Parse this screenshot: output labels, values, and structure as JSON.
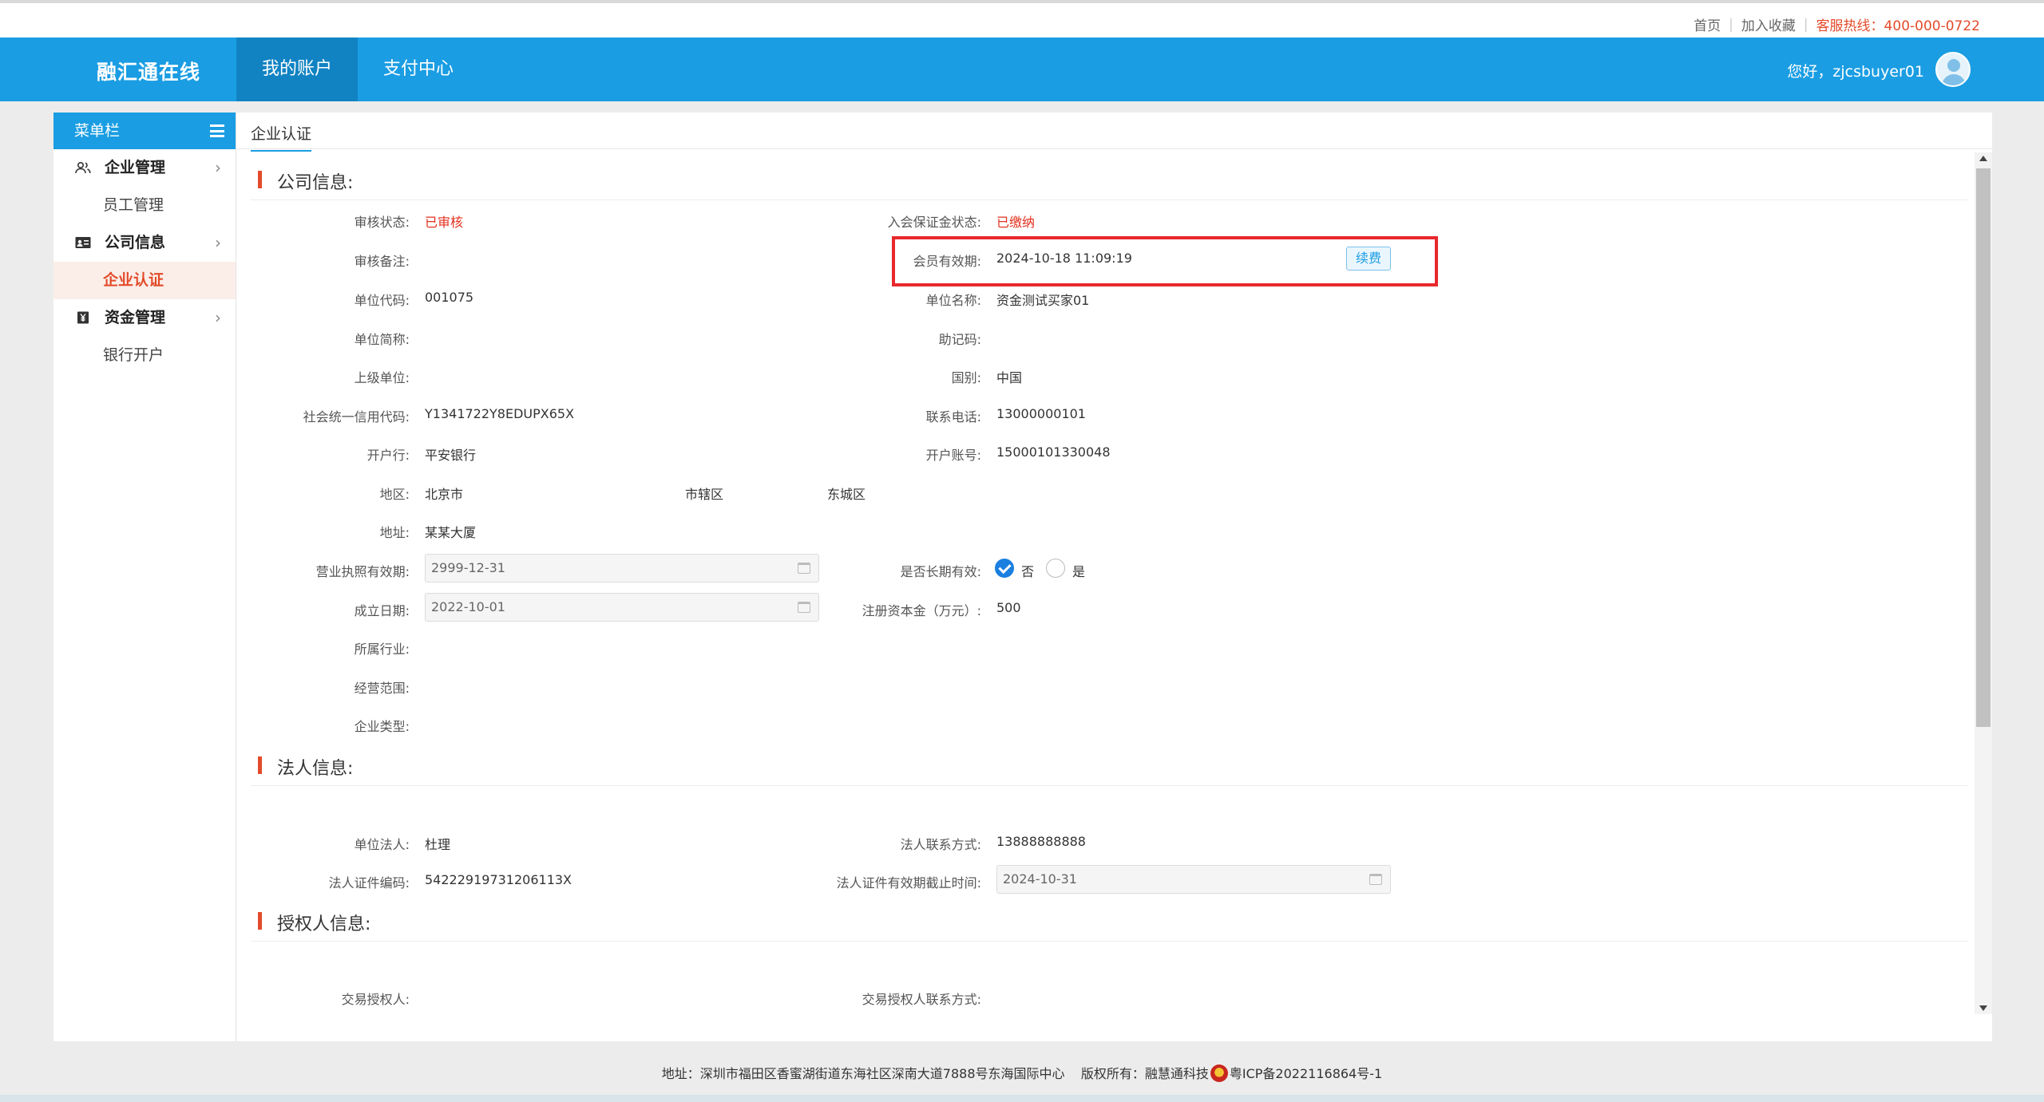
{
  "toplinks": {
    "home": "首页",
    "favorite": "加入收藏",
    "hotline": "客服热线：400-000-0722"
  },
  "header": {
    "logo": "融汇通在线",
    "nav": [
      "我的账户",
      "支付中心"
    ],
    "greeting": "您好，zjcsbuyer01"
  },
  "sidebar": {
    "title": "菜单栏",
    "groups": [
      {
        "label": "企业管理",
        "icon": "users-icon",
        "subs": [
          "员工管理"
        ]
      },
      {
        "label": "公司信息",
        "icon": "id-card-icon",
        "subs": [
          "企业认证"
        ]
      },
      {
        "label": "资金管理",
        "icon": "yen-box-icon",
        "subs": [
          "银行开户"
        ]
      }
    ],
    "active": "企业认证"
  },
  "tab": "企业认证",
  "company": {
    "title": "公司信息:",
    "audit_status_label": "审核状态:",
    "audit_status": "已审核",
    "deposit_label": "入会保证金状态:",
    "deposit": "已缴纳",
    "audit_note_label": "审核备注:",
    "member_expiry_label": "会员有效期:",
    "member_expiry": "2024-10-18 11:09:19",
    "renew": "续费",
    "unit_code_label": "单位代码:",
    "unit_code": "001075",
    "unit_name_label": "单位名称:",
    "unit_name": "资金测试买家01",
    "short_name_label": "单位简称:",
    "mnemonic_label": "助记码:",
    "parent_label": "上级单位:",
    "country_label": "国别:",
    "country": "中国",
    "credit_code_label": "社会统一信用代码:",
    "credit_code": "Y1341722Y8EDUPX65X",
    "phone_label": "联系电话:",
    "phone": "13000000101",
    "bank_label": "开户行:",
    "bank": "平安银行",
    "account_label": "开户账号:",
    "account": "15000101330048",
    "region_label": "地区:",
    "region": [
      "北京市",
      "市辖区",
      "东城区"
    ],
    "address_label": "地址:",
    "address": "某某大厦",
    "license_expiry_label": "营业执照有效期:",
    "license_expiry": "2999-12-31",
    "long_term_label": "是否长期有效:",
    "long_term_no": "否",
    "long_term_yes": "是",
    "found_date_label": "成立日期:",
    "found_date": "2022-10-01",
    "capital_label": "注册资本金（万元）:",
    "capital": "500",
    "industry_label": "所属行业:",
    "scope_label": "经营范围:",
    "type_label": "企业类型:"
  },
  "legal": {
    "title": "法人信息:",
    "person_label": "单位法人:",
    "person": "杜理",
    "contact_label": "法人联系方式:",
    "contact": "13888888888",
    "id_label": "法人证件编码:",
    "id": "54222919731206113X",
    "id_expiry_label": "法人证件有效期截止时间:",
    "id_expiry": "2024-10-31"
  },
  "authorized": {
    "title": "授权人信息:",
    "person_label": "交易授权人:",
    "contact_label": "交易授权人联系方式:"
  },
  "footer": {
    "address": "地址：深圳市福田区香蜜湖街道东海社区深南大道7888号东海国际中心",
    "copyright": "版权所有：融慧通科技",
    "icp": "粤ICP备2022116864号-1"
  },
  "colors": {
    "primary": "#1a9de3",
    "accent": "#e34b2a",
    "highlight": "#e8282d"
  }
}
